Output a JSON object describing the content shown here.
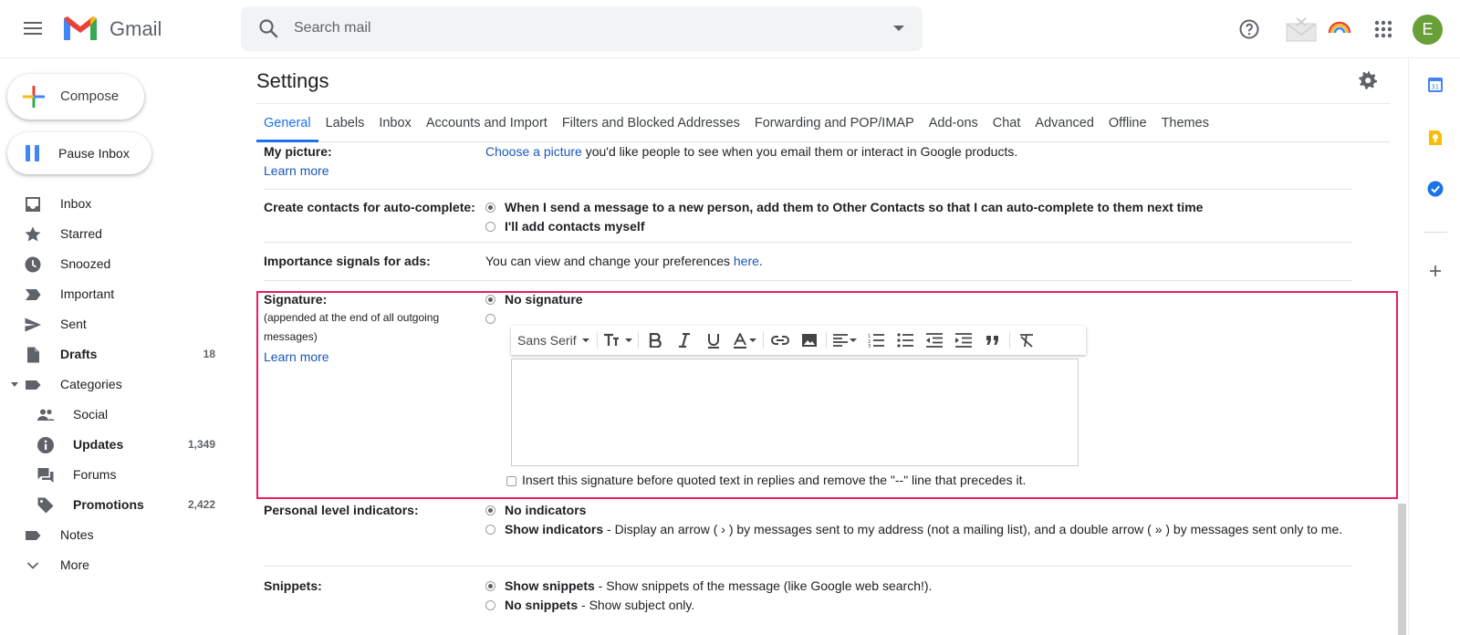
{
  "header": {
    "app_name": "Gmail",
    "search_placeholder": "Search mail",
    "avatar_letter": "E",
    "brand_colors": {
      "red": "#ea4335",
      "blue": "#4285f4",
      "green": "#34a853",
      "yellow": "#fbbc04"
    },
    "avatar_color": "#689f38"
  },
  "sidebar": {
    "compose_label": "Compose",
    "pause_label": "Pause Inbox",
    "items": [
      {
        "label": "Inbox",
        "count": "",
        "icon": "inbox-icon"
      },
      {
        "label": "Starred",
        "count": "",
        "icon": "star-icon"
      },
      {
        "label": "Snoozed",
        "count": "",
        "icon": "clock-icon"
      },
      {
        "label": "Important",
        "count": "",
        "icon": "important-icon"
      },
      {
        "label": "Sent",
        "count": "",
        "icon": "send-icon"
      },
      {
        "label": "Drafts",
        "count": "18",
        "icon": "draft-icon"
      },
      {
        "label": "Categories",
        "count": "",
        "icon": "label-icon"
      },
      {
        "label": "Social",
        "count": "",
        "icon": "people-icon"
      },
      {
        "label": "Updates",
        "count": "1,349",
        "icon": "info-icon"
      },
      {
        "label": "Forums",
        "count": "",
        "icon": "forum-icon"
      },
      {
        "label": "Promotions",
        "count": "2,422",
        "icon": "tag-icon"
      },
      {
        "label": "Notes",
        "count": "",
        "icon": "label-icon"
      },
      {
        "label": "More",
        "count": "",
        "icon": "chevron-down-icon"
      }
    ]
  },
  "settings": {
    "title": "Settings",
    "tabs": [
      "General",
      "Labels",
      "Inbox",
      "Accounts and Import",
      "Filters and Blocked Addresses",
      "Forwarding and POP/IMAP",
      "Add-ons",
      "Chat",
      "Advanced",
      "Offline",
      "Themes"
    ],
    "picture": {
      "label": "My picture:",
      "learn_more": "Learn more",
      "link": "Choose a picture",
      "text": " you'd like people to see when you email them or interact in Google products."
    },
    "contacts": {
      "label": "Create contacts for auto-complete:",
      "opt1": "When I send a message to a new person, add them to Other Contacts so that I can auto-complete to them next time",
      "opt2": "I'll add contacts myself"
    },
    "importance": {
      "label": "Importance signals for ads:",
      "text": "You can view and change your preferences ",
      "link": "here",
      "tail": "."
    },
    "signature": {
      "label": "Signature:",
      "sub": "(appended at the end of all outgoing messages)",
      "learn_more": "Learn more",
      "opt1": "No signature",
      "font": "Sans Serif",
      "checkbox": "Insert this signature before quoted text in replies and remove the \"--\" line that precedes it.",
      "highlight_color": "#ec1c5f"
    },
    "personal": {
      "label": "Personal level indicators:",
      "opt1": "No indicators",
      "opt2_bold": "Show indicators",
      "opt2_text": " - Display an arrow ( › ) by messages sent to my address (not a mailing list), and a double arrow ( » ) by messages sent only to me."
    },
    "snippets": {
      "label": "Snippets:",
      "opt1_bold": "Show snippets",
      "opt1_text": " - Show snippets of the message (like Google web search!).",
      "opt2_bold": "No snippets",
      "opt2_text": " - Show subject only."
    }
  }
}
